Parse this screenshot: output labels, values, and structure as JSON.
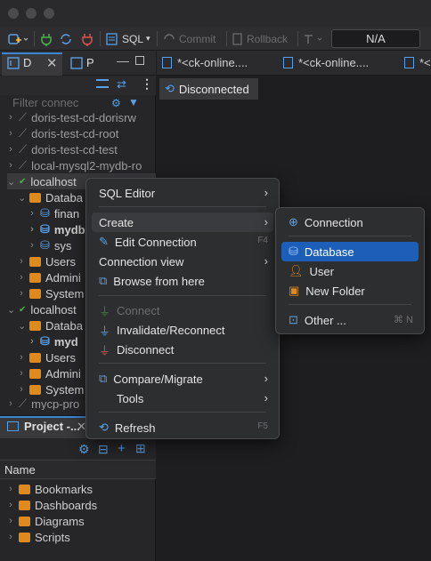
{
  "toolbar": {
    "sql_label": "SQL",
    "commit_label": "Commit",
    "rollback_label": "Rollback",
    "tx_mode_value": "N/A"
  },
  "left_panel": {
    "tab_db": "D",
    "tab_projects": "P",
    "filter_placeholder": "Filter connec",
    "tree": [
      "doris-test-cd-dorisrw",
      "doris-test-cd-root",
      "doris-test-cd-test",
      "local-mysql2-mydb-ro",
      "localhost",
      "Databa",
      "finan",
      "mydb",
      "sys",
      "Users",
      "Admini",
      "System",
      "localhost",
      "Databa",
      "myd",
      "Users",
      "Admini",
      "System",
      "mycp-pro"
    ]
  },
  "project_panel": {
    "title": "Project -...",
    "column_header": "Name",
    "items": [
      "Bookmarks",
      "Dashboards",
      "Diagrams",
      "Scripts"
    ]
  },
  "editor": {
    "tabs": [
      "*<ck-online....",
      "*<ck-online....",
      "*<"
    ],
    "subtab": "Disconnected"
  },
  "context_menu": {
    "items": {
      "sql_editor": "SQL Editor",
      "create": "Create",
      "edit_connection": "Edit Connection",
      "edit_connection_shortcut": "F4",
      "connection_view": "Connection view",
      "browse": "Browse from here",
      "connect": "Connect",
      "invalidate": "Invalidate/Reconnect",
      "disconnect": "Disconnect",
      "compare": "Compare/Migrate",
      "tools": "Tools",
      "refresh": "Refresh",
      "refresh_shortcut": "F5"
    }
  },
  "create_submenu": {
    "items": {
      "connection": "Connection",
      "database": "Database",
      "user": "User",
      "new_folder": "New Folder",
      "other": "Other ...",
      "other_shortcut": "⌘ N"
    }
  },
  "colors": {
    "accent": "#1d5fb8",
    "folder": "#e08a1e",
    "db_icon": "#5aa0e6",
    "plug_red": "#d9534f",
    "plug_green": "#4caf50"
  }
}
